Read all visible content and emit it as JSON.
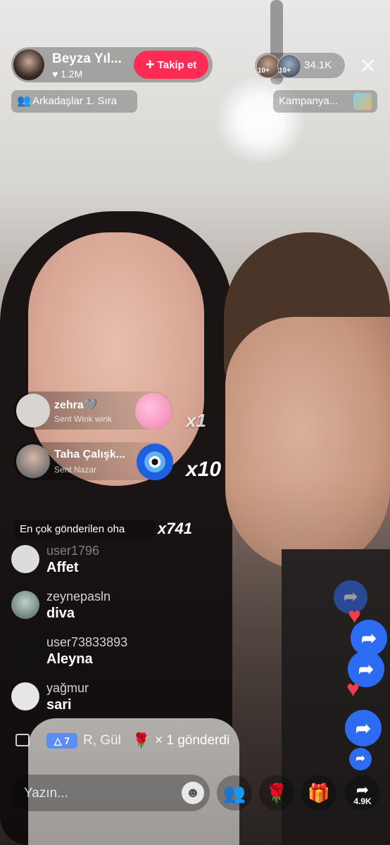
{
  "host": {
    "name": "Beyza Yıl...",
    "likes": "1.2M",
    "follow_label": "Takip et"
  },
  "viewers": {
    "badge1": "10+",
    "badge2": "10+",
    "count": "34.1K"
  },
  "close_label": "✕",
  "ranking": {
    "label": "Arkadaşlar 1. Sıra"
  },
  "campaign": {
    "label": "Kampanya..."
  },
  "gifts": [
    {
      "user": "zehra🩶",
      "sent": "Sent Wink wink",
      "multiplier": "x1"
    },
    {
      "user": "Taha Çalışk...",
      "sent": "Sent Nazar",
      "multiplier": "x10"
    }
  ],
  "top_gift": {
    "label": "En çok gönderilen oha",
    "multiplier": "x741"
  },
  "comments": [
    {
      "user": "user1796",
      "text": "Affet"
    },
    {
      "user": "zeynepasln",
      "text": "diva"
    },
    {
      "user": "user73833893",
      "text": "Aleyna"
    },
    {
      "user": "yağmur",
      "text": "sari"
    }
  ],
  "sent_line": {
    "level": "7",
    "who": "R, Gül",
    "message": "× 1 gönderdi"
  },
  "input": {
    "placeholder": "Yazın..."
  },
  "share": {
    "count": "4.9K"
  },
  "colors": {
    "accent": "#fe2c55",
    "share_blue": "#2e6bf3",
    "heart": "#ef3e4e"
  }
}
